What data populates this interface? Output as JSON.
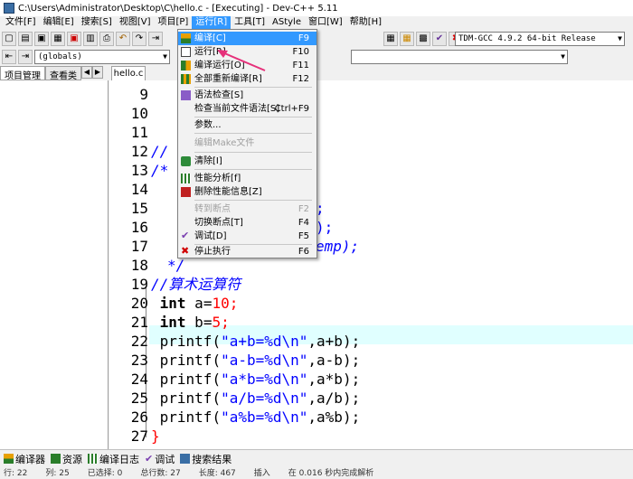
{
  "window": {
    "title": "C:\\Users\\Administrator\\Desktop\\C\\hello.c - [Executing] - Dev-C++ 5.11"
  },
  "menubar": [
    "文件[F]",
    "编辑[E]",
    "搜索[S]",
    "视图[V]",
    "项目[P]",
    "运行[R]",
    "工具[T]",
    "AStyle",
    "窗口[W]",
    "帮助[H]"
  ],
  "toolbar": {
    "compiler": "TDM-GCC 4.9.2 64-bit Release",
    "scope": "(globals)"
  },
  "left_tabs": [
    "项目管理",
    "查看类"
  ],
  "file_tab": "hello.c",
  "run_menu": {
    "items": [
      {
        "label": "编译[C]",
        "accel": "F9",
        "icon": "compile-icon"
      },
      {
        "label": "运行[R]",
        "accel": "F10",
        "icon": "run-icon"
      },
      {
        "label": "编译运行[O]",
        "accel": "F11",
        "icon": "compile-run-icon"
      },
      {
        "label": "全部重新编译[R]",
        "accel": "F12",
        "icon": "rebuild-icon"
      },
      {
        "label": "语法检查[S]",
        "accel": "",
        "icon": "syntax-icon"
      },
      {
        "label": "检查当前文件语法[S]",
        "accel": "Ctrl+F9",
        "icon": ""
      },
      {
        "label": "参数...",
        "accel": "",
        "icon": ""
      },
      {
        "label": "编辑Make文件",
        "accel": "",
        "icon": ""
      },
      {
        "label": "清除[I]",
        "accel": "",
        "icon": "clean-icon"
      },
      {
        "label": "性能分析[f]",
        "accel": "",
        "icon": "profile-icon"
      },
      {
        "label": "删除性能信息[Z]",
        "accel": "",
        "icon": "delete-profile-icon"
      },
      {
        "label": "转到断点",
        "accel": "F2",
        "icon": ""
      },
      {
        "label": "切换断点[T]",
        "accel": "F4",
        "icon": ""
      },
      {
        "label": "调试[D]",
        "accel": "F5",
        "icon": "debug-icon"
      },
      {
        "label": "停止执行",
        "accel": "F6",
        "icon": "stop-icon"
      }
    ]
  },
  "editor": {
    "line_numbers": [
      "9",
      "10",
      "11",
      "12",
      "13",
      "14",
      "15",
      "16",
      "17",
      "18",
      "19",
      "20",
      "21",
      "22",
      "23",
      "24",
      "25",
      "26",
      "27"
    ],
    "partial": {
      "l12": "//",
      "l13": "/*",
      "l15": ";",
      "l16": ");",
      "l17": "emp);",
      "l18": "*/"
    },
    "code": {
      "l19": "//算术运算符",
      "l20_kw": "int",
      "l20_rest": " a=",
      "l20_num": "10",
      "l20_end": ";",
      "l21_kw": "int",
      "l21_rest": " b=",
      "l21_num": "5",
      "l21_end": ";",
      "printf": [
        {
          "fn": "printf(",
          "str": "\"a+b=%d\\n\"",
          "tail": ",a+b);"
        },
        {
          "fn": "printf(",
          "str": "\"a-b=%d\\n\"",
          "tail": ",a-b);"
        },
        {
          "fn": "printf(",
          "str": "\"a*b=%d\\n\"",
          "tail": ",a*b);"
        },
        {
          "fn": "printf(",
          "str": "\"a/b=%d\\n\"",
          "tail": ",a/b);"
        },
        {
          "fn": "printf(",
          "str": "\"a%b=%d\\n\"",
          "tail": ",a%b);"
        }
      ],
      "l27": "}"
    }
  },
  "bottom_tabs": [
    "编译器",
    "资源",
    "编译日志",
    "调试",
    "搜索结果"
  ],
  "statusbar": [
    "行:   22",
    "列:   25",
    "已选择:   0",
    "总行数:   27",
    "长度:   467",
    "插入",
    "在 0.016 秒内完成解析"
  ]
}
